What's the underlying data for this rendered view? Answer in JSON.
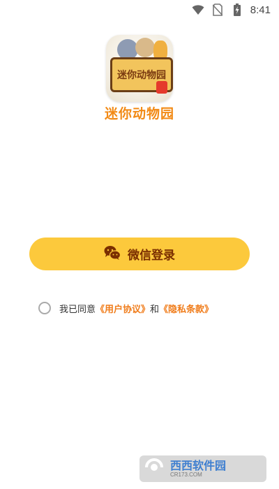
{
  "status_bar": {
    "time": "8:41",
    "icons": [
      "wifi-icon",
      "no-sim-icon",
      "battery-charging-icon"
    ]
  },
  "app": {
    "icon_sign_text": "迷你动物园",
    "name": "迷你动物园"
  },
  "login": {
    "wechat_button_label": "微信登录"
  },
  "agreement": {
    "prefix": "我已同意",
    "user_agreement": "《用户协议》",
    "conjunction": "和",
    "privacy_policy": "《隐私条款》"
  },
  "watermark": {
    "text": "西西软件园",
    "sub": "CR173.COM"
  },
  "colors": {
    "accent_orange": "#f28a15",
    "button_yellow": "#fcc93c",
    "button_text": "#7a2e00",
    "link_orange": "#f07c1a"
  }
}
